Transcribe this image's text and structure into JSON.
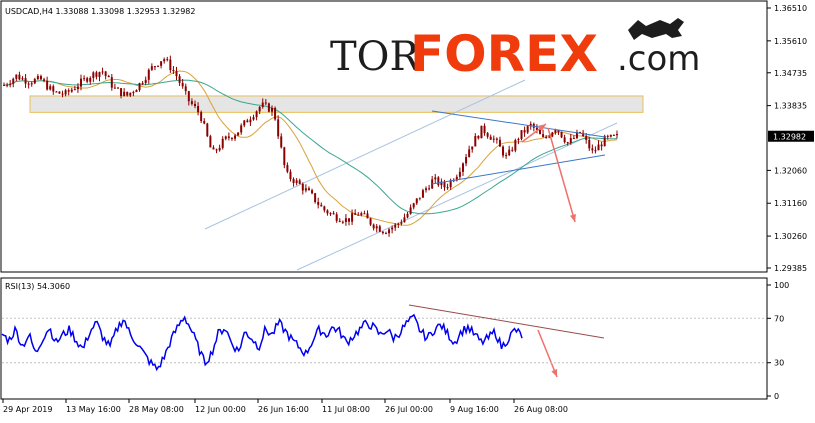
{
  "header": {
    "symbol_info": "USDCAD,H4 1.33088 1.33098 1.32953 1.32982",
    "rsi_label": "RSI(13) 54.3060"
  },
  "logo": {
    "part1": "TOR",
    "part2": "FOREX",
    "part3": ".com",
    "accent_color": "#f03c0c"
  },
  "colors": {
    "candle": "#8b0000",
    "ma_fast": "#d9a23b",
    "ma_slow": "#3aa68f",
    "channel": "#a9c3e3",
    "triangle": "#3a78c9",
    "arrow": "#f0706a",
    "rsi_line": "#0000ee",
    "rsi_trend": "#9a4b4b",
    "zone_fill": "#dcdcdc",
    "zone_border": "#e8c05a",
    "current_price_bg": "#000000"
  },
  "chart_data": [
    {
      "type": "candlestick",
      "title": "USDCAD,H4 1.33088 1.33098 1.32953 1.32982",
      "x_tick_labels": [
        "29 Apr 2019",
        "13 May 16:00",
        "28 May 08:00",
        "12 Jun 00:00",
        "26 Jun 16:00",
        "11 Jul 08:00",
        "26 Jul 00:00",
        "9 Aug 16:00",
        "26 Aug 08:00"
      ],
      "y_tick_labels": [
        "1.36510",
        "1.35610",
        "1.34735",
        "1.33835",
        "1.32982",
        "1.32060",
        "1.31160",
        "1.30260",
        "1.29385"
      ],
      "ylim": [
        1.29385,
        1.3651
      ],
      "current_price": "1.32982",
      "close_path": [
        [
          0,
          1.344
        ],
        [
          0.02,
          1.3465
        ],
        [
          0.04,
          1.345
        ],
        [
          0.06,
          1.3455
        ],
        [
          0.08,
          1.342
        ],
        [
          0.1,
          1.3415
        ],
        [
          0.12,
          1.344
        ],
        [
          0.14,
          1.3465
        ],
        [
          0.16,
          1.348
        ],
        [
          0.18,
          1.343
        ],
        [
          0.2,
          1.341
        ],
        [
          0.22,
          1.344
        ],
        [
          0.24,
          1.3485
        ],
        [
          0.26,
          1.3515
        ],
        [
          0.28,
          1.347
        ],
        [
          0.3,
          1.34
        ],
        [
          0.32,
          1.336
        ],
        [
          0.34,
          1.325
        ],
        [
          0.36,
          1.329
        ],
        [
          0.38,
          1.331
        ],
        [
          0.4,
          1.335
        ],
        [
          0.42,
          1.3385
        ],
        [
          0.44,
          1.337
        ],
        [
          0.46,
          1.3195
        ],
        [
          0.48,
          1.317
        ],
        [
          0.5,
          1.314
        ],
        [
          0.52,
          1.31
        ],
        [
          0.54,
          1.308
        ],
        [
          0.56,
          1.307
        ],
        [
          0.58,
          1.309
        ],
        [
          0.6,
          1.306
        ],
        [
          0.62,
          1.304
        ],
        [
          0.64,
          1.3055
        ],
        [
          0.66,
          1.309
        ],
        [
          0.68,
          1.314
        ],
        [
          0.7,
          1.318
        ],
        [
          0.72,
          1.316
        ],
        [
          0.74,
          1.32
        ],
        [
          0.76,
          1.327
        ],
        [
          0.78,
          1.332
        ],
        [
          0.8,
          1.329
        ],
        [
          0.82,
          1.324
        ],
        [
          0.84,
          1.33
        ],
        [
          0.86,
          1.333
        ],
        [
          0.88,
          1.329
        ],
        [
          0.9,
          1.3325
        ],
        [
          0.92,
          1.328
        ],
        [
          0.94,
          1.331
        ],
        [
          0.96,
          1.3255
        ],
        [
          0.98,
          1.329
        ],
        [
          1.0,
          1.3298
        ]
      ],
      "resistance_zone": [
        1.3365,
        1.341
      ],
      "lines": [
        "ascending channel",
        "triangle",
        "moving averages"
      ]
    },
    {
      "type": "line",
      "title": "RSI(13) 54.3060",
      "y_tick_labels": [
        "100",
        "70",
        "30",
        "0"
      ],
      "ylim": [
        0,
        100
      ],
      "levels": [
        70,
        30
      ],
      "last_value": 54.306,
      "values": [
        56,
        50,
        60,
        45,
        55,
        38,
        52,
        62,
        48,
        55,
        60,
        50,
        42,
        58,
        66,
        52,
        44,
        60,
        70,
        55,
        48,
        38,
        30,
        24,
        35,
        50,
        62,
        72,
        60,
        45,
        30,
        38,
        56,
        62,
        48,
        40,
        58,
        52,
        44,
        60,
        55,
        66,
        58,
        50,
        44,
        38,
        50,
        60,
        55,
        62,
        58,
        48,
        54,
        60,
        66,
        62,
        55,
        60,
        52,
        58,
        66,
        70,
        58,
        52,
        60,
        64,
        56,
        48,
        58,
        62,
        55,
        48,
        52,
        58,
        44,
        52,
        60,
        54
      ]
    }
  ]
}
